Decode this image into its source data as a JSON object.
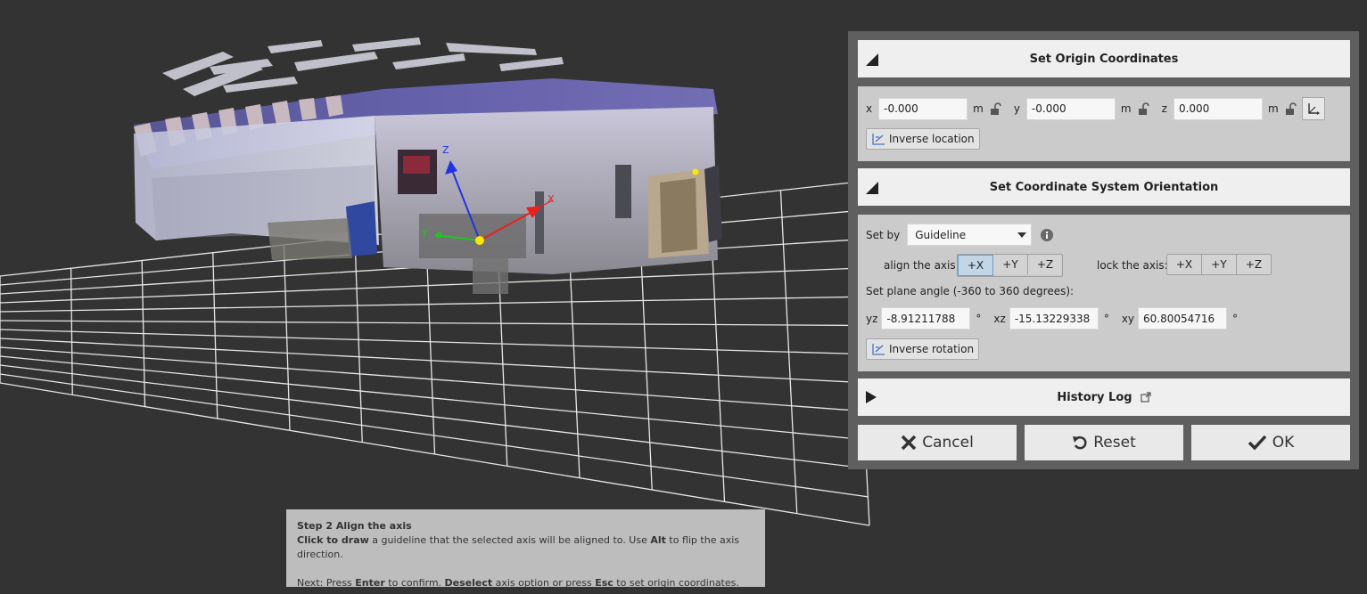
{
  "viewport": {
    "axis_labels": {
      "x": "X",
      "y": "Y",
      "z": "Z"
    }
  },
  "origin": {
    "title": "Set Origin Coordinates",
    "x_label": "x",
    "x_value": "-0.000",
    "y_label": "y",
    "y_value": "-0.000",
    "z_label": "z",
    "z_value": "0.000",
    "unit": "m",
    "inverse_label": "Inverse location"
  },
  "orientation": {
    "title": "Set Coordinate System Orientation",
    "set_by_label": "Set by",
    "set_by_value": "Guideline",
    "align_label": "align the axis:",
    "lock_label": "lock the axis:",
    "align_options": [
      "+X",
      "+Y",
      "+Z"
    ],
    "align_selected": "+X",
    "lock_options": [
      "+X",
      "+Y",
      "+Z"
    ],
    "plane_angle_label": "Set plane angle (-360 to 360 degrees):",
    "yz_label": "yz",
    "yz_value": "-8.91211788",
    "xz_label": "xz",
    "xz_value": "-15.13229338",
    "xy_label": "xy",
    "xy_value": "60.80054716",
    "degree": "°",
    "inverse_label": "Inverse rotation"
  },
  "history": {
    "title": "History Log"
  },
  "buttons": {
    "cancel": "Cancel",
    "reset": "Reset",
    "ok": "OK"
  },
  "hint": {
    "step": "Step 2 Align the axis",
    "l1_b1": "Click to draw",
    "l1_t1": " a guideline that the selected axis will be aligned to. Use ",
    "l1_b2": "Alt",
    "l1_t2": " to flip the axis direction.",
    "l2_t1": "Next: Press ",
    "l2_b1": "Enter",
    "l2_t2": " to confirm. ",
    "l2_b2": "Deselect",
    "l2_t3": " axis option or press ",
    "l2_b3": "Esc",
    "l2_t4": " to set origin coordinates."
  },
  "colors": {
    "background": "#333333",
    "grid": "#e6e6e6",
    "axis_x": "#e8211f",
    "axis_y": "#22c422",
    "axis_z": "#2233e0",
    "origin_point": "#ffe600",
    "accent_selected": "#c2d6e8"
  },
  "icons": [
    "lock-open-icon",
    "axis-pick-icon",
    "inverse-icon",
    "info-icon",
    "dropdown-arrow-icon",
    "external-link-icon",
    "close-x-icon",
    "reset-icon",
    "check-icon",
    "collapse-triangle-icon",
    "expand-triangle-icon"
  ]
}
